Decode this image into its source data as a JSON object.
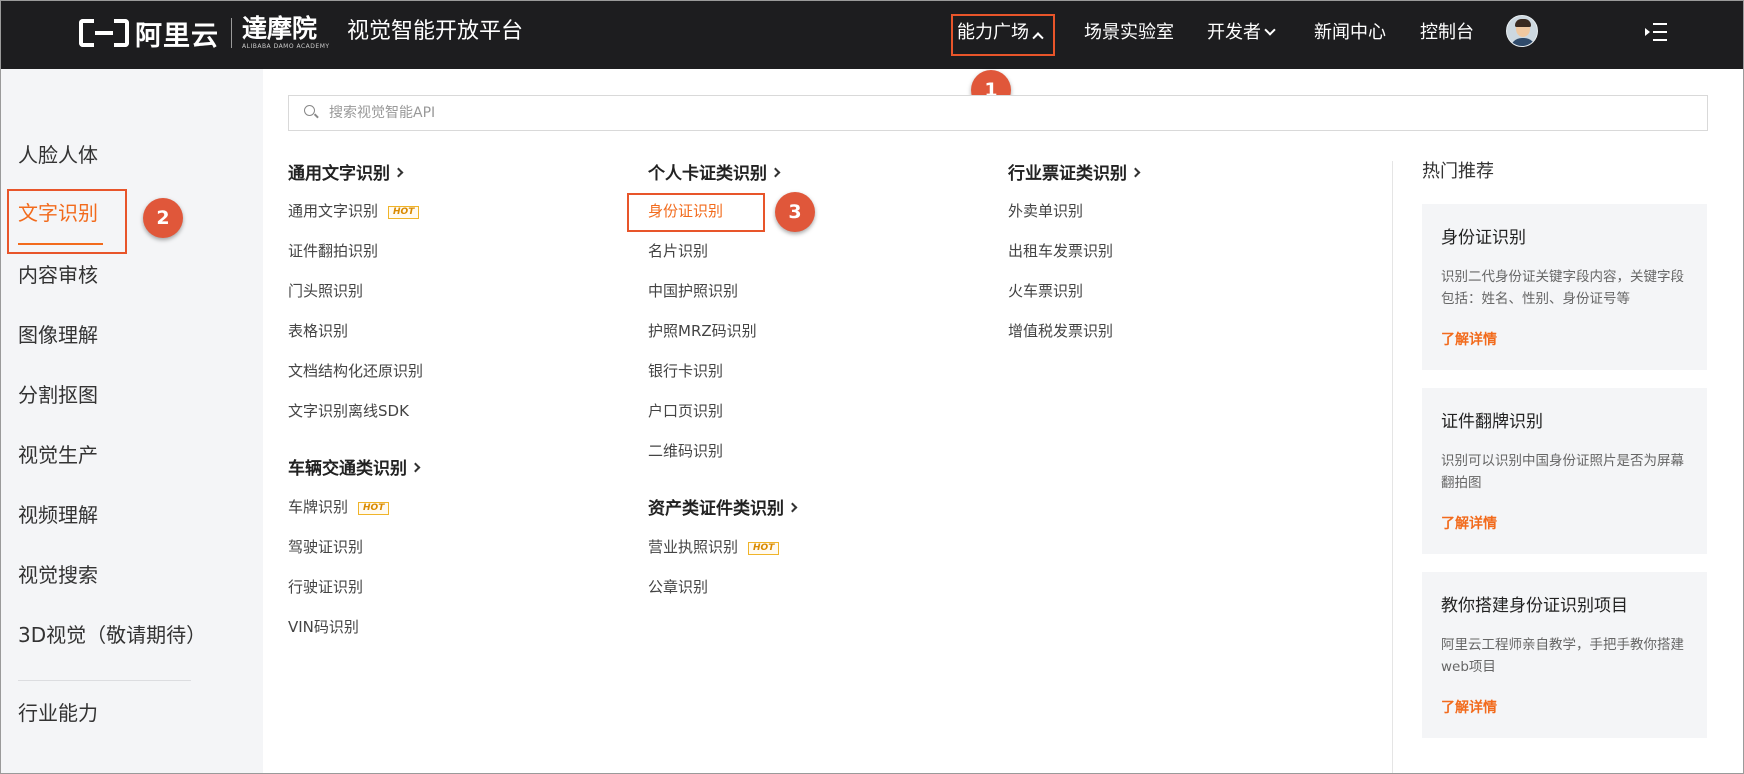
{
  "header": {
    "logo_text": "阿里云",
    "damo_cn": "達摩院",
    "damo_en": "ALIBABA DAMO ACADEMY",
    "platform_title": "视觉智能开放平台",
    "nav": {
      "ability": "能力广场",
      "lab": "场景实验室",
      "developer": "开发者",
      "news": "新闻中心",
      "console": "控制台"
    }
  },
  "sidebar": {
    "items": [
      "人脸人体",
      "文字识别",
      "内容审核",
      "图像理解",
      "分割抠图",
      "视觉生产",
      "视频理解",
      "视觉搜索",
      "3D视觉（敬请期待）",
      "行业能力"
    ],
    "active_index": 1
  },
  "search": {
    "placeholder": "搜索视觉智能API"
  },
  "columns": {
    "general": {
      "title": "通用文字识别",
      "items": [
        "通用文字识别",
        "证件翻拍识别",
        "门头照识别",
        "表格识别",
        "文档结构化还原识别",
        "文字识别离线SDK"
      ]
    },
    "vehicle": {
      "title": "车辆交通类识别",
      "items": [
        "车牌识别",
        "驾驶证识别",
        "行驶证识别",
        "VIN码识别"
      ]
    },
    "personal": {
      "title": "个人卡证类识别",
      "items": [
        "身份证识别",
        "名片识别",
        "中国护照识别",
        "护照MRZ码识别",
        "银行卡识别",
        "户口页识别",
        "二维码识别"
      ]
    },
    "assets": {
      "title": "资产类证件类识别",
      "items": [
        "营业执照识别",
        "公章识别"
      ]
    },
    "industry": {
      "title": "行业票证类识别",
      "items": [
        "外卖单识别",
        "出租车发票识别",
        "火车票识别",
        "增值税发票识别"
      ]
    }
  },
  "hot_badge": "HOT",
  "recommend": {
    "title": "热门推荐",
    "cards": [
      {
        "title": "身份证识别",
        "desc": "识别二代身份证关键字段内容，关键字段包括：姓名、性别、身份证号等",
        "link": "了解详情"
      },
      {
        "title": "证件翻牌识别",
        "desc": "识别可以识别中国身份证照片是否为屏幕翻拍图",
        "link": "了解详情"
      },
      {
        "title": "教你搭建身份证识别项目",
        "desc": "阿里云工程师亲自教学，手把手教你搭建web项目",
        "link": "了解详情"
      }
    ]
  },
  "annotations": {
    "step1": "1",
    "step2": "2",
    "step3": "3"
  },
  "colors": {
    "accent": "#f26b1d",
    "topbar": "#1d1d1f",
    "annotation": "#e0573a"
  }
}
